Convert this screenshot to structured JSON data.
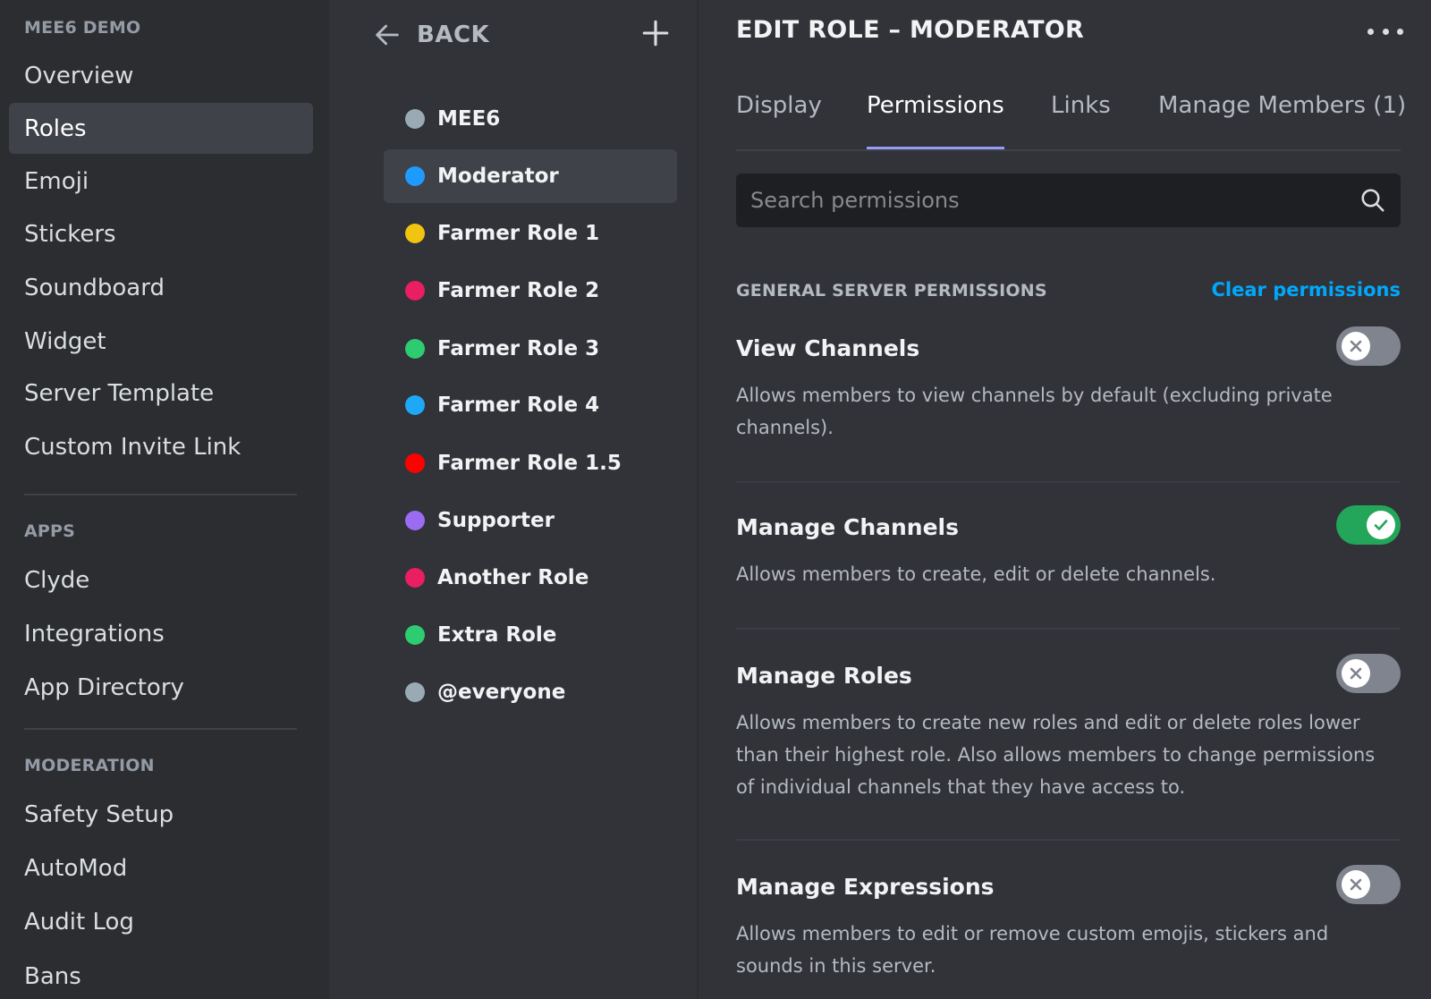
{
  "sidebar": {
    "server_header": "MEE6 DEMO",
    "server_items": [
      {
        "label": "Overview",
        "active": false
      },
      {
        "label": "Roles",
        "active": true
      },
      {
        "label": "Emoji",
        "active": false
      },
      {
        "label": "Stickers",
        "active": false
      },
      {
        "label": "Soundboard",
        "active": false
      },
      {
        "label": "Widget",
        "active": false
      },
      {
        "label": "Server Template",
        "active": false
      },
      {
        "label": "Custom Invite Link",
        "active": false
      }
    ],
    "apps_header": "APPS",
    "apps_items": [
      {
        "label": "Clyde"
      },
      {
        "label": "Integrations"
      },
      {
        "label": "App Directory"
      }
    ],
    "moderation_header": "MODERATION",
    "moderation_items": [
      {
        "label": "Safety Setup"
      },
      {
        "label": "AutoMod"
      },
      {
        "label": "Audit Log"
      },
      {
        "label": "Bans"
      }
    ]
  },
  "roles_panel": {
    "back_label": "BACK",
    "add_icon": "plus-icon",
    "back_icon": "arrow-left-icon",
    "roles": [
      {
        "name": "MEE6",
        "color": "#99aab5",
        "active": false
      },
      {
        "name": "Moderator",
        "color": "#1e9bff",
        "active": true
      },
      {
        "name": "Farmer Role 1",
        "color": "#f1c40f",
        "active": false
      },
      {
        "name": "Farmer Role 2",
        "color": "#e91e63",
        "active": false
      },
      {
        "name": "Farmer Role 3",
        "color": "#2ecc71",
        "active": false
      },
      {
        "name": "Farmer Role 4",
        "color": "#1ea8f5",
        "active": false
      },
      {
        "name": "Farmer Role 1.5",
        "color": "#ff0000",
        "active": false
      },
      {
        "name": "Supporter",
        "color": "#9b6bf2",
        "active": false
      },
      {
        "name": "Another Role",
        "color": "#e91e63",
        "active": false
      },
      {
        "name": "Extra Role",
        "color": "#2ecc71",
        "active": false
      },
      {
        "name": "@everyone",
        "color": "#99aab5",
        "active": false
      }
    ]
  },
  "editor": {
    "title": "EDIT ROLE – MODERATOR",
    "more_icon": "more-horizontal-icon",
    "tabs": [
      {
        "label": "Display",
        "active": false
      },
      {
        "label": "Permissions",
        "active": true
      },
      {
        "label": "Links",
        "active": false
      },
      {
        "label": "Manage Members (1)",
        "active": false
      }
    ],
    "search": {
      "placeholder": "Search permissions",
      "value": "",
      "icon": "search-icon"
    },
    "section_label": "GENERAL SERVER PERMISSIONS",
    "clear_label": "Clear permissions",
    "permissions": [
      {
        "title": "View Channels",
        "description": "Allows members to view channels by default (excluding private channels).",
        "enabled": false
      },
      {
        "title": "Manage Channels",
        "description": "Allows members to create, edit or delete channels.",
        "enabled": true
      },
      {
        "title": "Manage Roles",
        "description": "Allows members to create new roles and edit or delete roles lower than their highest role. Also allows members to change permissions of individual channels that they have access to.",
        "enabled": false
      },
      {
        "title": "Manage Expressions",
        "description": "Allows members to edit or remove custom emojis, stickers and sounds in this server.",
        "enabled": false
      }
    ]
  },
  "colors": {
    "toggle_on": "#23a55a",
    "toggle_off": "#80848e",
    "link": "#00a8fc",
    "tab_underline": "#949cf7"
  }
}
